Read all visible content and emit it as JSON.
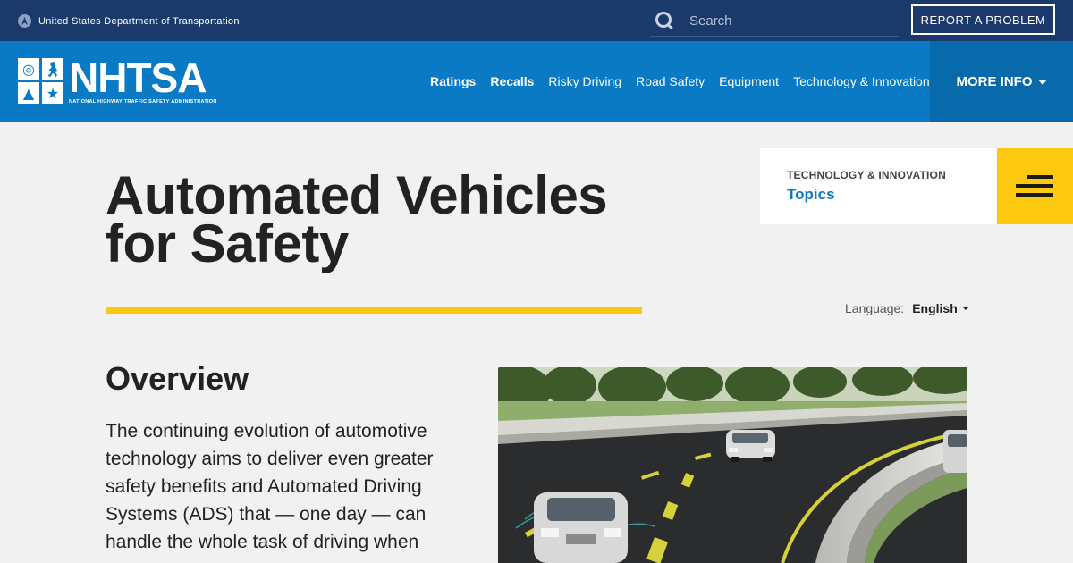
{
  "topbar": {
    "agency": "United States Department of Transportation",
    "search_placeholder": "Search",
    "report_label": "REPORT A PROBLEM"
  },
  "logo": {
    "wordmark": "NHTSA",
    "fullname": "NATIONAL HIGHWAY TRAFFIC SAFETY ADMINISTRATION"
  },
  "nav": {
    "items": [
      {
        "label": "Ratings",
        "bold": true
      },
      {
        "label": "Recalls",
        "bold": true
      },
      {
        "label": "Risky Driving",
        "bold": false
      },
      {
        "label": "Road Safety",
        "bold": false
      },
      {
        "label": "Equipment",
        "bold": false
      },
      {
        "label": "Technology & Innovation",
        "bold": false
      }
    ],
    "more_info": "MORE INFO"
  },
  "page": {
    "title_line1": "Automated Vehicles",
    "title_line2": "for Safety",
    "topics_kicker": "TECHNOLOGY & INNOVATION",
    "topics_label": "Topics",
    "language_label": "Language:",
    "language_value": "English",
    "overview_heading": "Overview",
    "overview_text": "The continuing evolution of automotive technology aims to deliver even greater safety benefits and Automated Driving Systems (ADS) that — one day — can handle the whole task of driving when"
  },
  "colors": {
    "topbar": "#1b3a6b",
    "nav": "#0a7ac4",
    "more_info_bg": "#0869ab",
    "accent_yellow": "#fcc90e",
    "link_blue": "#0a7ac4"
  }
}
